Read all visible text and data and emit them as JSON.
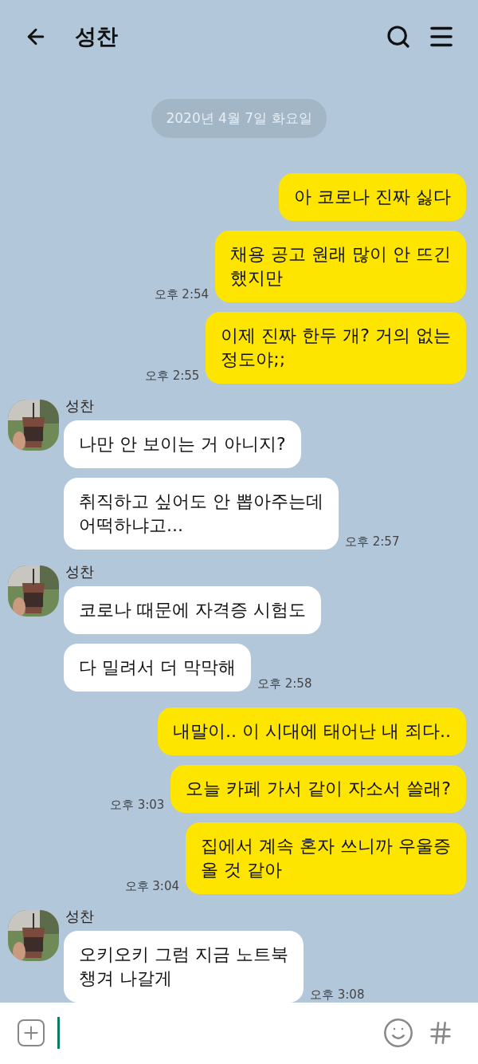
{
  "header": {
    "title": "성찬"
  },
  "date": "2020년 4월 7일 화요일",
  "groups": [
    {
      "kind": "me",
      "messages": [
        {
          "text": "아 코로나 진짜 싫다"
        },
        {
          "text": "채용 공고 원래 많이 안 뜨긴\n했지만",
          "time": "오후 2:54"
        },
        {
          "text": "이제 진짜 한두 개? 거의 없는\n정도야;;",
          "time": "오후 2:55"
        }
      ]
    },
    {
      "kind": "friend",
      "name": "성찬",
      "messages": [
        {
          "text": "나만 안 보이는 거 아니지?"
        },
        {
          "text": "취직하고 싶어도 안 뽑아주는데\n어떡하냐고...",
          "time": "오후 2:57"
        }
      ]
    },
    {
      "kind": "friend",
      "name": "성찬",
      "messages": [
        {
          "text": "코로나 때문에 자격증 시험도"
        },
        {
          "text": "다 밀려서 더 막막해",
          "time": "오후 2:58"
        }
      ]
    },
    {
      "kind": "me",
      "messages": [
        {
          "text": "내말이.. 이 시대에 태어난 내 죄다.."
        },
        {
          "text": "오늘 카페 가서 같이 자소서 쓸래?",
          "time": "오후 3:03"
        },
        {
          "text": "집에서 계속 혼자 쓰니까 우울증\n올 것 같아",
          "time": "오후 3:04"
        }
      ]
    },
    {
      "kind": "friend",
      "name": "성찬",
      "messages": [
        {
          "text": "오키오키 그럼 지금 노트북\n챙겨 나갈게",
          "time": "오후 3:08"
        }
      ]
    }
  ]
}
